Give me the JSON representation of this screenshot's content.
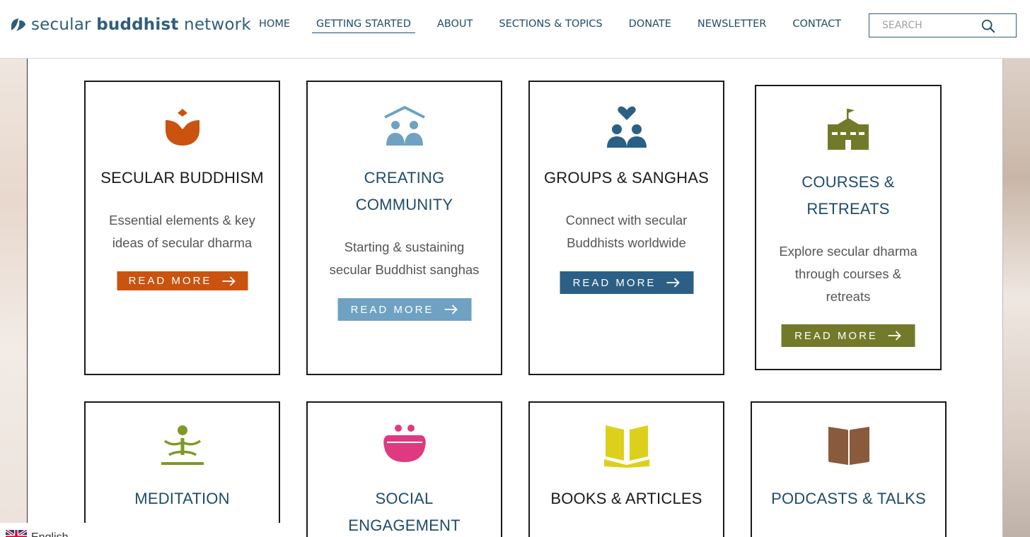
{
  "header": {
    "logo": {
      "word1": "secular",
      "word2": "buddhist",
      "word3": "network"
    },
    "nav": [
      "HOME",
      "GETTING STARTED",
      "ABOUT",
      "SECTIONS & TOPICS",
      "DONATE",
      "NEWSLETTER",
      "CONTACT"
    ],
    "active_nav": "GETTING STARTED",
    "search_placeholder": "SEARCH"
  },
  "cards_row1": [
    {
      "title_lines": [
        "SECULAR BUDDHISM"
      ],
      "desc_lines": [
        "Essential elements & key",
        "ideas of secular dharma"
      ],
      "button": "READ MORE",
      "color": "#c9530f",
      "icon": "lotus-icon"
    },
    {
      "title_lines": [
        "CREATING",
        "COMMUNITY"
      ],
      "desc_lines": [
        "Starting & sustaining",
        "secular Buddhist sanghas"
      ],
      "button": "READ MORE",
      "color": "#6fa2c2",
      "icon": "community-house-icon"
    },
    {
      "title_lines": [
        "GROUPS & SANGHAS"
      ],
      "desc_lines": [
        "Connect with secular",
        "Buddhists worldwide"
      ],
      "button": "READ MORE",
      "color": "#2c5f85",
      "icon": "group-heart-icon"
    },
    {
      "title_lines": [
        "COURSES &",
        "RETREATS"
      ],
      "desc_lines": [
        "Explore secular dharma",
        "through courses &",
        "retreats"
      ],
      "button": "READ MORE",
      "color": "#727a2a",
      "icon": "school-building-icon"
    }
  ],
  "cards_row2": [
    {
      "title_lines": [
        "MEDITATION"
      ],
      "color": "#7d9a26",
      "icon": "meditation-icon"
    },
    {
      "title_lines": [
        "SOCIAL",
        "ENGAGEMENT"
      ],
      "color": "#df3a80",
      "icon": "social-pot-icon"
    },
    {
      "title_lines": [
        "BOOKS & ARTICLES"
      ],
      "color": "#ddd01c",
      "icon": "open-book-icon"
    },
    {
      "title_lines": [
        "PODCASTS & TALKS"
      ],
      "color": "#8a5a3c",
      "icon": "closed-book-icon"
    }
  ],
  "lang_bar": {
    "text": "English",
    "icon": "uk-flag-icon"
  }
}
